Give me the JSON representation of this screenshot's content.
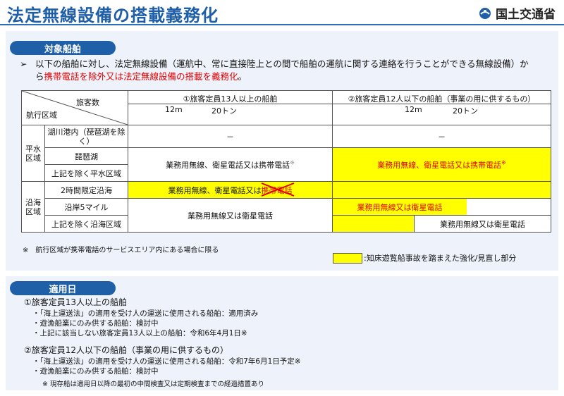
{
  "header": {
    "title": "法定無線設備の搭載義務化",
    "logo_text": "国土交通省"
  },
  "section1": {
    "tab": "対象船舶",
    "lead_arrow": "➢",
    "lead_part1": "以下の船舶に対し、法定無線設備（運航中、常に直接陸上との間で船舶の運航に関する連絡を行うことができる無線設備）から",
    "lead_part2_red": "携帯電話を除外又は法定無線設備の搭載を義務化",
    "lead_part3": "。"
  },
  "table": {
    "hdr_passengers": "旅客数",
    "hdr_area": "航行区域",
    "col1_title": "①旅客定員13人以上の船舶",
    "col2_title": "②旅客定員12人以下の船舶（事業の用に供するもの）",
    "tick_12m": "12m",
    "tick_20t": "20トン",
    "group_heisui": "平水区域",
    "group_engan": "沿海区域",
    "row_kosen": "湖川港内（琵琶湖を除く）",
    "row_biwako": "琵琶湖",
    "row_heisui_other": "上記を除く平水区域",
    "row_2h": "2時間限定沿海",
    "row_5mile": "沿岸5マイル",
    "row_engan_other": "上記を除く沿海区域",
    "dash": "－",
    "cell_gyomu_eisei_keitai": "業務用無線、衛星電話又は携帯電話",
    "note_mark": "※",
    "cell_2h_text": "業務用無線、衛星電話又は",
    "cell_2h_struck": "携帯電話",
    "cell_gyomu_or_eisei": "業務用無線又は衛星電話",
    "cell_gyomu_or_eisei_red": "業務用無線又は衛星電話"
  },
  "notes": {
    "area_note": "※　航行区域が携帯電話のサービスエリア内にある場合に限る",
    "legend": ":知床遊覧船事故を踏まえた強化/見直し部分"
  },
  "section2": {
    "tab": "適用日",
    "g1_title": "①旅客定員13人以上の船舶",
    "g1_items": [
      "・「海上運送法」の適用を受け人の運送に使用される船舶：適用済み",
      "・遊漁船業にのみ供する船舶：検討中",
      "・上記に該当しない旅客定員13人以上の船舶：令和6年4月1日※"
    ],
    "g2_title": "②旅客定員12人以下の船舶（事業の用に供するもの）",
    "g2_items": [
      "・「海上運送法」の適用を受け人の運送に使用される船舶：令和7年6月1日予定※",
      "・遊漁船業にのみ供する船舶：検討中"
    ],
    "footnote": "※ 現存船は適用日以降の最初の中間検査又は定期検査までの経過措置あり"
  },
  "colors": {
    "brand": "#1f5fa8",
    "highlight": "#ffff00",
    "red": "#e00000"
  }
}
